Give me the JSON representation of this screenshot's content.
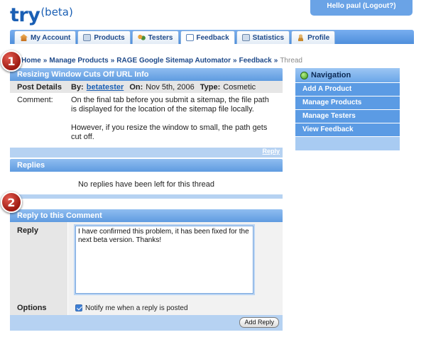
{
  "app": {
    "logo": "try",
    "logo_suffix": "(beta)"
  },
  "user": {
    "greeting": "Hello paul (Logout?)"
  },
  "tabs": [
    {
      "label": "My Account",
      "icon": "home-icon"
    },
    {
      "label": "Products",
      "icon": "document-icon"
    },
    {
      "label": "Testers",
      "icon": "people-icon"
    },
    {
      "label": "Feedback",
      "icon": "chat-icon",
      "active": true
    },
    {
      "label": "Statistics",
      "icon": "chart-icon"
    },
    {
      "label": "Profile",
      "icon": "user-icon"
    }
  ],
  "breadcrumb": {
    "items": [
      "Home",
      "Manage Products",
      "RAGE Google Sitemap Automator",
      "Feedback"
    ],
    "current": "Thread",
    "separator": "»"
  },
  "badges": [
    "1",
    "2"
  ],
  "thread": {
    "title": "Resizing Window Cuts Off URL Info",
    "details_label": "Post Details",
    "by_label": "By:",
    "author": "betatester",
    "on_label": "On:",
    "date": "Nov 5th, 2006",
    "type_label": "Type:",
    "type": "Cosmetic",
    "comment_label": "Comment:",
    "comment_p1": "On the final tab before you submit a sitemap, the file path is displayed for the location of the sitemap file locally.",
    "comment_p2": "However, if you resize the window to small, the path gets cut off.",
    "reply_link": "Reply"
  },
  "replies": {
    "title": "Replies",
    "empty_message": "No replies have been left for this thread"
  },
  "reply_form": {
    "title": "Reply to this Comment",
    "reply_label": "Reply",
    "reply_text": "I have confirmed this problem, it has been fixed for the next beta version. Thanks!",
    "options_label": "Options",
    "notify_label": "Notify me when a reply is posted",
    "notify_checked": true,
    "submit_label": "Add Reply"
  },
  "navigation": {
    "title": "Navigation",
    "items": [
      "Add A Product",
      "Manage Products",
      "Manage Testers",
      "View Feedback"
    ]
  },
  "colors": {
    "accent": "#5b9be4",
    "brand": "#1a5fb4",
    "badge": "#b52a20"
  }
}
